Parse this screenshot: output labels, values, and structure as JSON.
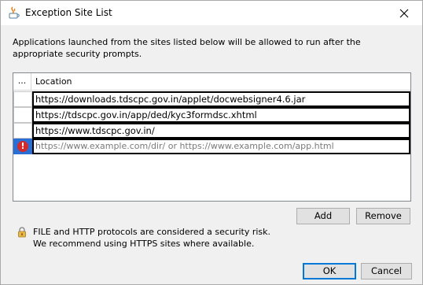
{
  "window": {
    "title": "Exception Site List",
    "close_icon": "close-icon",
    "app_icon": "java-icon"
  },
  "description": "Applications launched from the sites listed below will be allowed to run after the appropriate security prompts.",
  "table": {
    "columns": [
      "...",
      "Location"
    ],
    "rows": [
      {
        "location": "https://downloads.tdscpc.gov.in/applet/docwebsigner4.6.jar",
        "status": ""
      },
      {
        "location": "https://tdscpc.gov.in/app/ded/kyc3formdsc.xhtml",
        "status": ""
      },
      {
        "location": "https://www.tdscpc.gov.in/",
        "status": ""
      }
    ],
    "new_row_placeholder": "https://www.example.com/dir/ or https://www.example.com/app.html",
    "new_row_status_icon": "error-icon"
  },
  "buttons": {
    "add": "Add",
    "remove": "Remove",
    "ok": "OK",
    "cancel": "Cancel"
  },
  "security_note": {
    "icon": "lock-icon",
    "line1": "FILE and HTTP protocols are considered a security risk.",
    "line2": "We recommend using HTTPS sites where available."
  },
  "colors": {
    "selection": "#2a6fd6",
    "error": "#d22b2b",
    "default_button_border": "#0078d7"
  }
}
